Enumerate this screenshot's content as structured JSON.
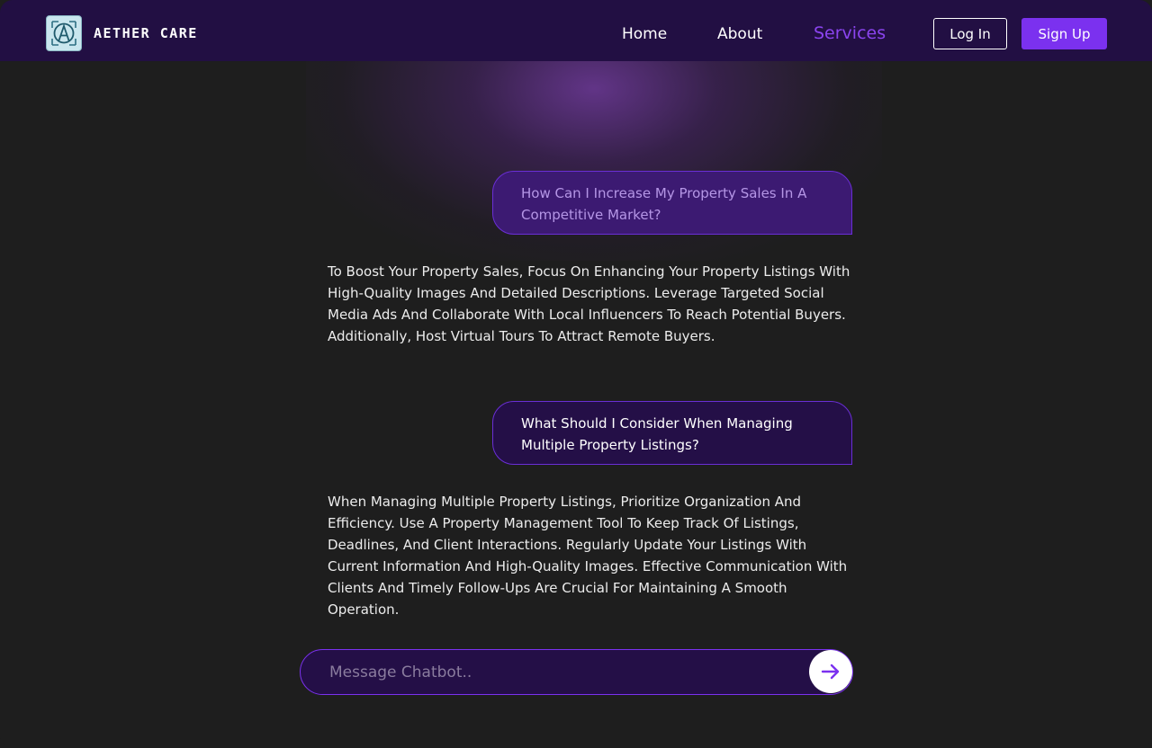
{
  "header": {
    "brand_name": "AETHER CARE",
    "logo_icon": "aether-care-logo",
    "nav": [
      {
        "label": "Home",
        "active": false
      },
      {
        "label": "About",
        "active": false
      },
      {
        "label": "Services",
        "active": true
      }
    ],
    "login_label": "Log In",
    "signup_label": "Sign Up"
  },
  "chat": {
    "messages": [
      {
        "role": "user",
        "text": "How Can I Increase My Property Sales In A Competitive Market?"
      },
      {
        "role": "bot",
        "text": "To Boost Your Property Sales, Focus On Enhancing Your Property Listings With High-Quality Images And Detailed Descriptions. Leverage Targeted Social Media Ads And Collaborate With Local Influencers To Reach Potential Buyers. Additionally, Host Virtual Tours To Attract Remote Buyers."
      },
      {
        "role": "user",
        "text": "What Should I Consider When Managing Multiple Property Listings?"
      },
      {
        "role": "bot",
        "text": "When Managing Multiple Property Listings, Prioritize Organization And Efficiency. Use A Property Management Tool To Keep Track Of Listings, Deadlines, And Client Interactions. Regularly Update Your Listings With Current Information And High-Quality Images. Effective Communication With Clients And Timely Follow-Ups Are Crucial For Maintaining A Smooth Operation."
      }
    ],
    "input": {
      "value": "",
      "placeholder": "Message Chatbot.."
    },
    "send_icon": "arrow-right-icon"
  },
  "colors": {
    "header_bg": "#220f43",
    "page_bg": "#1e1e1e",
    "accent": "#7b31ef",
    "active_nav": "#8b44f0"
  }
}
